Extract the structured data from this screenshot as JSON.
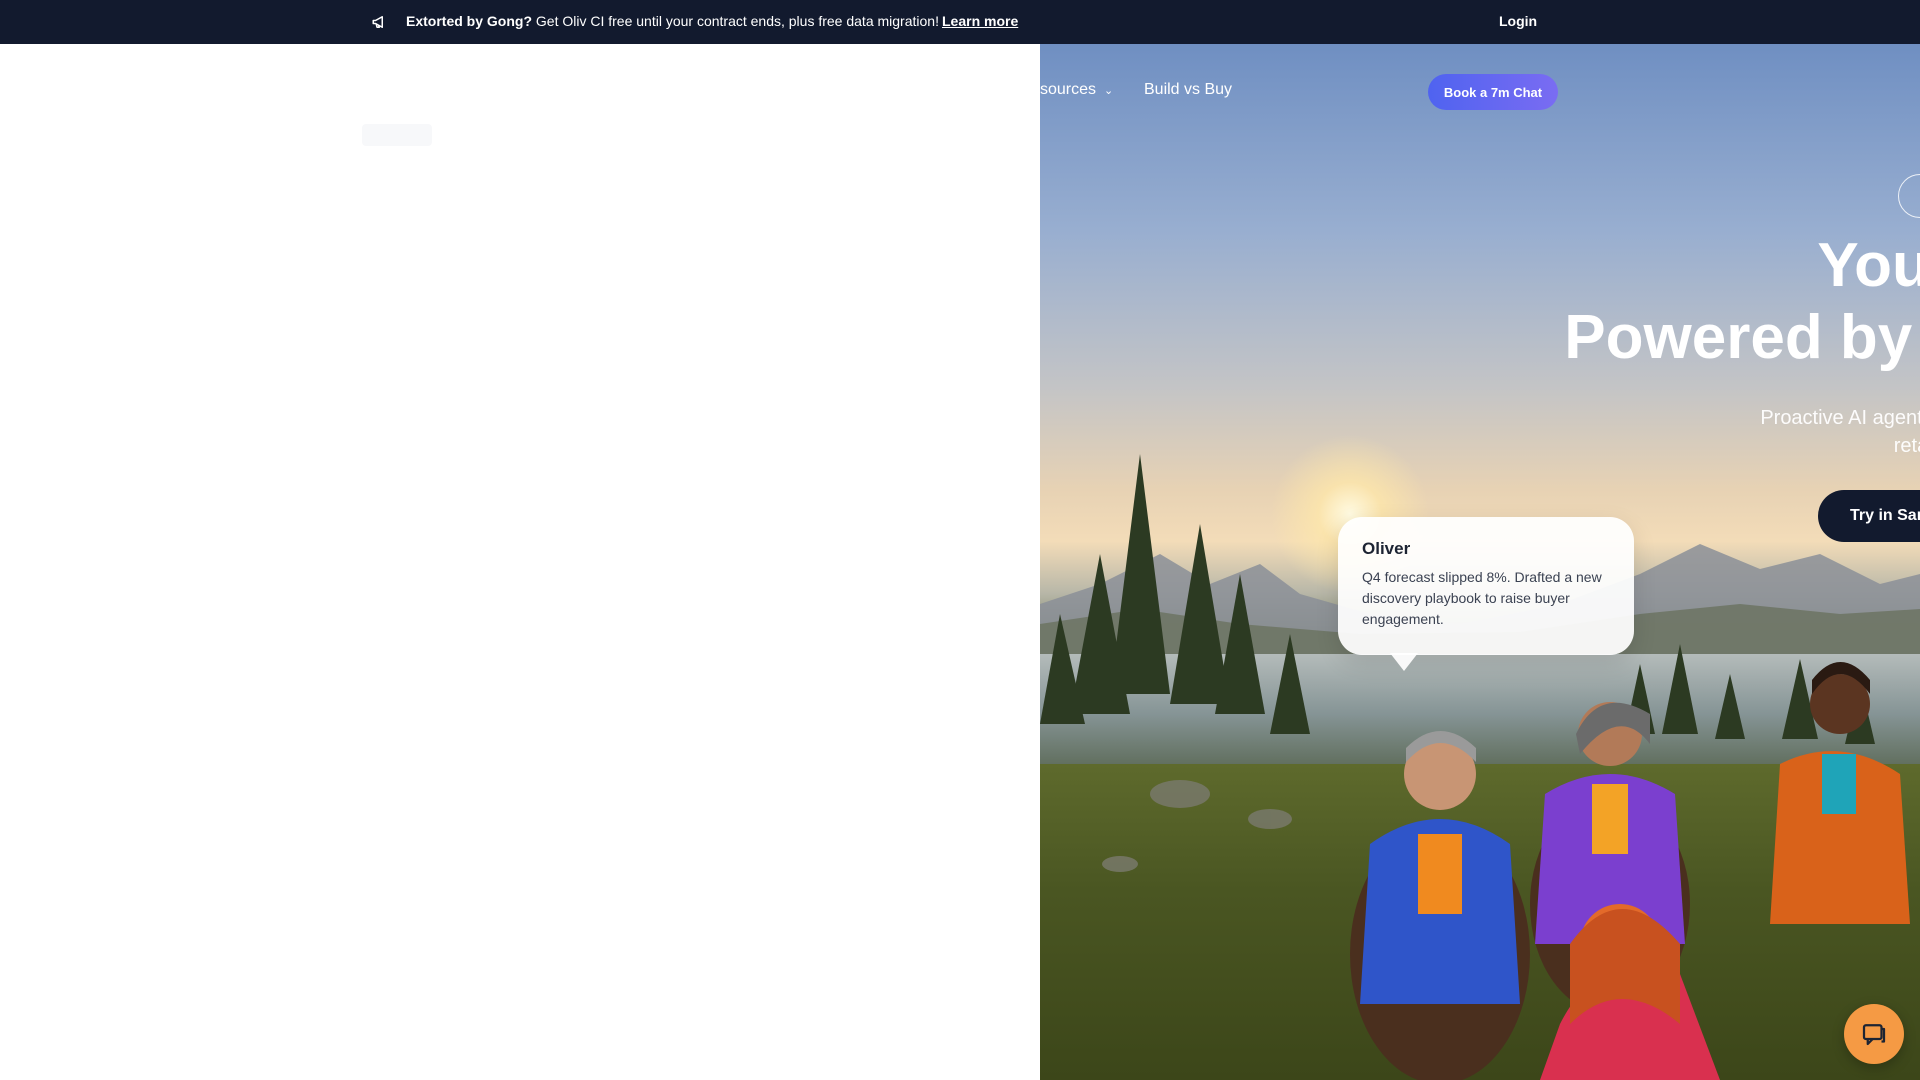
{
  "announcement": {
    "bold": "Extorted by Gong?",
    "message": " Get Oliv CI free until your contract ends, plus free data migration!",
    "link": "Learn more",
    "login": "Login"
  },
  "nav": {
    "resources": "sources",
    "build_vs_buy": "Build vs Buy",
    "cta": "Book a 7m Chat"
  },
  "hero": {
    "headline_line1": "Your R",
    "headline_line2": "Powered by A",
    "subtitle_line1": "Proactive AI agents tha",
    "subtitle_line2": "retain, a",
    "primary_button": "Try in San"
  },
  "chat_bubble": {
    "name": "Oliver",
    "text": "Q4 forecast slipped 8%. Drafted a new discovery playbook to raise buyer engagement."
  },
  "icons": {
    "announcement": "megaphone-icon",
    "dropdown": "chevron-down-icon",
    "chat": "chat-icon"
  },
  "colors": {
    "announcement_bg": "#121a2e",
    "cta_gradient_start": "#4f63f0",
    "cta_gradient_end": "#7a6cf2",
    "primary_button_bg": "#121a2e",
    "chat_launcher": "#f59a44"
  }
}
